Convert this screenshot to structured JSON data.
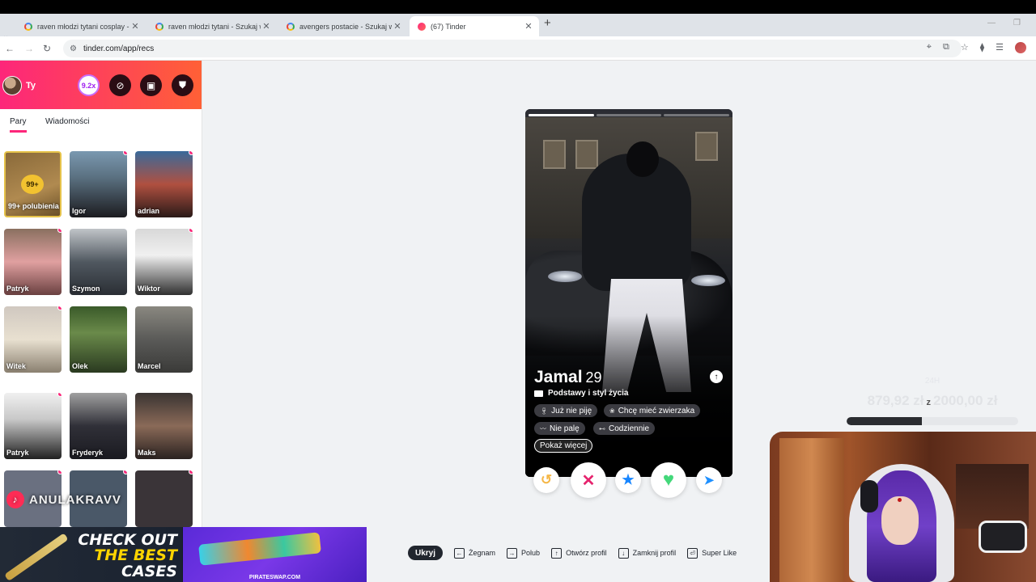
{
  "browser": {
    "tabs": [
      {
        "title": "raven młodzi tytani cosplay - S",
        "icon": "google-icon"
      },
      {
        "title": "raven młodzi tytani - Szukaj w G",
        "icon": "google-icon"
      },
      {
        "title": "avengers postacie - Szukaj w G",
        "icon": "google-icon"
      },
      {
        "title": "(67) Tinder",
        "icon": "tinder-icon"
      }
    ],
    "url": "tinder.com/app/recs"
  },
  "sidebar": {
    "user_label": "Ty",
    "boost_label": "9.2x",
    "tabs": [
      "Pary",
      "Wiadomości"
    ],
    "likes": {
      "count": "99+",
      "label": "99+ polubienia"
    },
    "matches": [
      {
        "name": "Igor",
        "new": true
      },
      {
        "name": "adrian",
        "new": true
      },
      {
        "name": "Patryk",
        "new": true
      },
      {
        "name": "Szymon",
        "new": false
      },
      {
        "name": "Wiktor",
        "new": true
      },
      {
        "name": "Witek",
        "new": true
      },
      {
        "name": "Olek",
        "new": false
      },
      {
        "name": "Marcel",
        "new": false
      },
      {
        "name": "Patryk",
        "new": true
      },
      {
        "name": "Fryderyk",
        "new": false
      },
      {
        "name": "Maks",
        "new": false
      }
    ]
  },
  "overlay": {
    "tiktok_handle": "ANULAKRAVV",
    "ad_line1": "CHECK OUT",
    "ad_line2": "THE BEST",
    "ad_line3": "CASES",
    "ad_brand": "PIRATESWAP.COM"
  },
  "profile": {
    "name": "Jamal",
    "age": "29",
    "section": "Podstawy i styl życia",
    "chips": [
      {
        "label": "Już nie piję",
        "icon": "glass-icon"
      },
      {
        "label": "Chcę mieć zwierzaka",
        "icon": "paw-icon"
      },
      {
        "label": "Nie palę",
        "icon": "smoke-icon"
      },
      {
        "label": "Codziennie",
        "icon": "dumbbell-icon"
      }
    ],
    "more_label": "Pokaż więcej",
    "photo_count": 3,
    "photo_index": 1
  },
  "actions": {
    "rewind": "↺",
    "nope": "✕",
    "superlike": "★",
    "like": "♥",
    "boost": "➤"
  },
  "hints": {
    "hide": "Ukryj",
    "items": [
      {
        "key": "←",
        "label": "Żegnam"
      },
      {
        "key": "→",
        "label": "Polub"
      },
      {
        "key": "↑",
        "label": "Otwórz profil"
      },
      {
        "key": "↓",
        "label": "Zamknij profil"
      },
      {
        "key": "⏎",
        "label": "Super Like"
      }
    ]
  },
  "goal": {
    "period": "24H",
    "current": "879,92 zł",
    "sep": "z",
    "target": "2000,00 zł",
    "progress": 0.44
  },
  "colors": {
    "brand_gradient_start": "#fd267a",
    "brand_gradient_end": "#ff6036",
    "nope": "#e6246e",
    "superlike": "#1786ff",
    "like": "#43d87a",
    "rewind": "#f5b748",
    "boost": "#1e90ff"
  }
}
